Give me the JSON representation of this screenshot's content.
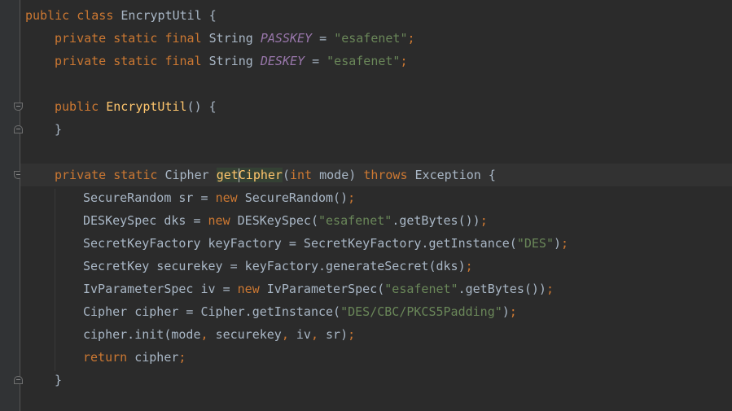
{
  "editor": {
    "lines": {
      "l1": {
        "t1": "public class ",
        "t2": "EncryptUtil",
        "t3": " {"
      },
      "l2": {
        "t1": "private static final ",
        "t2": "String ",
        "t3": "PASSKEY",
        "t4": " = ",
        "t5": "\"esafenet\"",
        "t6": ";"
      },
      "l3": {
        "t1": "private static final ",
        "t2": "String ",
        "t3": "DESKEY",
        "t4": " = ",
        "t5": "\"esafenet\"",
        "t6": ";"
      },
      "l5": {
        "t1": "public ",
        "t2": "EncryptUtil",
        "t3": "() {"
      },
      "l6": {
        "t1": "}"
      },
      "l8": {
        "t1": "private static ",
        "t2": "Cipher ",
        "t3a": "get",
        "t3b": "Cipher",
        "t4": "(",
        "t5": "int ",
        "t6": "mode) ",
        "t7": "throws ",
        "t8": "Exception {"
      },
      "l9": {
        "t1": "SecureRandom sr = ",
        "t2": "new ",
        "t3": "SecureRandom()",
        "t4": ";"
      },
      "l10": {
        "t1": "DESKeySpec dks = ",
        "t2": "new ",
        "t3": "DESKeySpec(",
        "t4": "\"esafenet\"",
        "t5": ".getBytes())",
        "t6": ";"
      },
      "l11": {
        "t1": "SecretKeyFactory keyFactory = SecretKeyFactory.getInstance(",
        "t2": "\"DES\"",
        "t3": ")",
        "t4": ";"
      },
      "l12": {
        "t1": "SecretKey securekey = keyFactory.generateSecret(dks)",
        "t2": ";"
      },
      "l13": {
        "t1": "IvParameterSpec iv = ",
        "t2": "new ",
        "t3": "IvParameterSpec(",
        "t4": "\"esafenet\"",
        "t5": ".getBytes())",
        "t6": ";"
      },
      "l14": {
        "t1": "Cipher cipher = Cipher.getInstance(",
        "t2": "\"DES/CBC/PKCS5Padding\"",
        "t3": ")",
        "t4": ";"
      },
      "l15": {
        "t1": "cipher.init(mode",
        "t2": ", ",
        "t3": "securekey",
        "t4": ", ",
        "t5": "iv",
        "t6": ", ",
        "t7": "sr)",
        "t8": ";"
      },
      "l16": {
        "t1": "return ",
        "t2": "cipher",
        "t3": ";"
      },
      "l17": {
        "t1": "}"
      }
    }
  }
}
